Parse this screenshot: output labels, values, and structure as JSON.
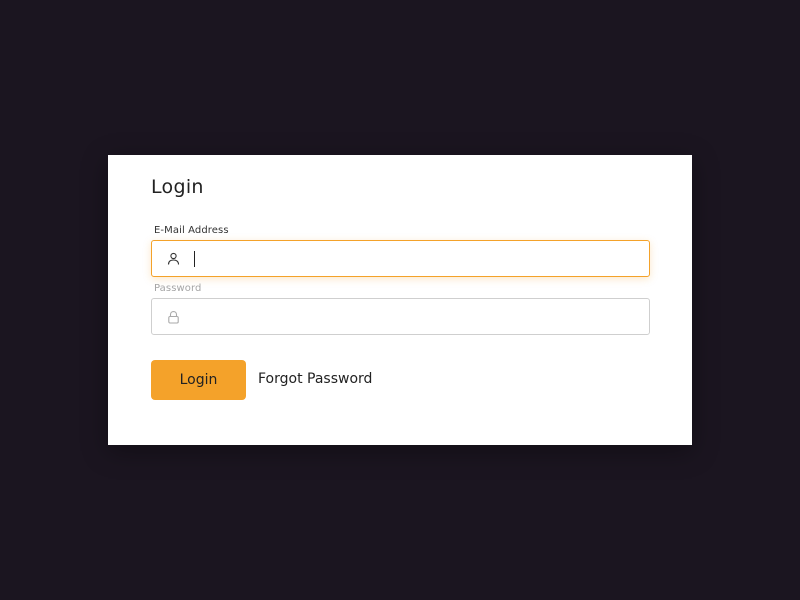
{
  "login_form": {
    "title": "Login",
    "email": {
      "label": "E-Mail Address",
      "value": "",
      "placeholder": "",
      "icon": "user-icon",
      "focused": true
    },
    "password": {
      "label": "Password",
      "value": "",
      "placeholder": "",
      "icon": "lock-icon"
    },
    "login_button_label": "Login",
    "forgot_password_label": "Forgot Password"
  },
  "colors": {
    "page_background": "#1b1520",
    "card_background": "#ffffff",
    "accent": "#f4a22a",
    "text": "#222222",
    "muted_label": "#a5a5a5"
  }
}
